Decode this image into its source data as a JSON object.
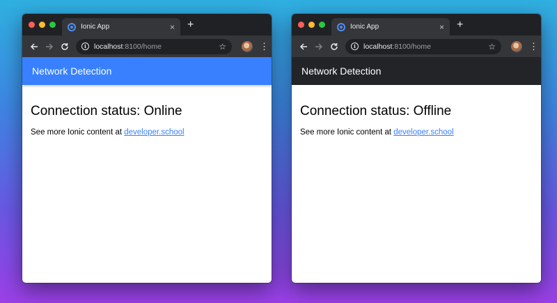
{
  "windows": [
    {
      "tab": {
        "title": "Ionic App",
        "close": "×"
      },
      "new_tab": "+",
      "address": {
        "host": "localhost",
        "rest": ":8100/home"
      },
      "header": {
        "title": "Network Detection",
        "color": "#3880ff"
      },
      "content": {
        "status": "Connection status: Online",
        "text": "See more Ionic content at ",
        "link": "developer.school"
      }
    },
    {
      "tab": {
        "title": "Ionic App",
        "close": "×"
      },
      "new_tab": "+",
      "address": {
        "host": "localhost",
        "rest": ":8100/home"
      },
      "header": {
        "title": "Network Detection",
        "color": "#222428"
      },
      "content": {
        "status": "Connection status: Offline",
        "text": "See more Ionic content at ",
        "link": "developer.school"
      }
    }
  ],
  "icons": {
    "back": "arrow-left-icon",
    "forward": "arrow-right-icon",
    "reload": "reload-icon",
    "info": "info-icon",
    "star": "star-icon",
    "menu": "vertical-dots-icon"
  }
}
